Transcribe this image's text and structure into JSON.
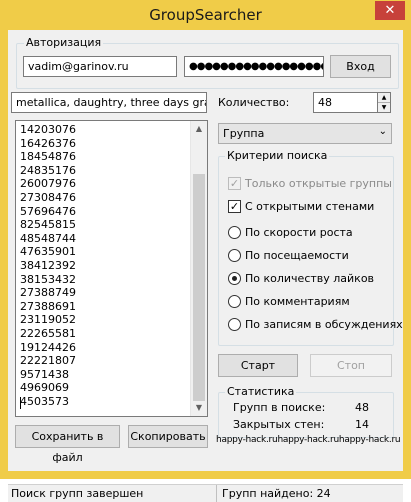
{
  "window": {
    "title": "GroupSearcher",
    "close_glyph": "✕"
  },
  "auth": {
    "legend": "Авторизация",
    "login_value": "vadim@garinov.ru",
    "password_value": "●●●●●●●●●●●●●●●●●●●●●●",
    "login_button": "Вход"
  },
  "search": {
    "query_value": "metallica, daughtry, three days grace",
    "count_label": "Количество:",
    "count_value": "48",
    "type_value": "Группа"
  },
  "results": {
    "ids": [
      "14203076",
      "16426376",
      "18454876",
      "24835176",
      "26007976",
      "27308476",
      "57696476",
      "82545815",
      "48548744",
      "47635901",
      "38412392",
      "38153432",
      "27388749",
      "27388691",
      "23119052",
      "22265581",
      "19124426",
      "22221807",
      "9571438",
      "4969069",
      "4503573"
    ]
  },
  "criteria": {
    "legend": "Критерии поиска",
    "only_open": {
      "label": "Только открытые группы",
      "checked": true,
      "disabled": true
    },
    "open_walls": {
      "label": "С открытыми стенами",
      "checked": true
    },
    "sort_options": [
      {
        "label": "По скорости роста",
        "selected": false
      },
      {
        "label": "По посещаемости",
        "selected": false
      },
      {
        "label": "По количеству лайков",
        "selected": true
      },
      {
        "label": "По комментариям",
        "selected": false
      },
      {
        "label": "По записям в обсуждениях",
        "selected": false
      }
    ]
  },
  "actions": {
    "start": "Старт",
    "stop": "Стоп",
    "save": "Сохранить в файл",
    "copy": "Скопировать"
  },
  "stats": {
    "legend": "Статистика",
    "groups_label": "Групп в поиске:",
    "groups_value": "48",
    "closed_label": "Закрытых стен:",
    "closed_value": "14",
    "watermark": "happy-hack.ruhappy-hack.ruhappy-hack.ru"
  },
  "status": {
    "left": "Поиск групп завершен",
    "right": "Групп найдено: 24"
  },
  "icons": {
    "spin_up": "up-arrow-icon",
    "spin_down": "down-arrow-icon",
    "combo": "chevron-down-icon",
    "close": "close-icon"
  }
}
